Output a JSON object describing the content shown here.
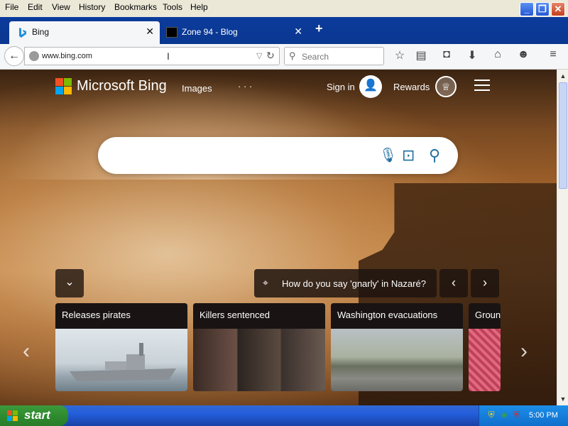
{
  "menu": {
    "items": [
      "File",
      "Edit",
      "View",
      "History",
      "Bookmarks",
      "Tools",
      "Help"
    ]
  },
  "window_controls": {
    "minimize": "_",
    "maximize": "❐",
    "close": "✕"
  },
  "tabs": [
    {
      "title": "Bing",
      "icon": "bing-logo-icon",
      "active": true
    },
    {
      "title": "Zone 94 - Blog",
      "icon": "zone94-favicon-icon",
      "active": false
    }
  ],
  "new_tab_label": "+",
  "navbar": {
    "url": "www.bing.com",
    "search_placeholder": "Search",
    "icons": [
      "star-icon",
      "reading-list-icon",
      "pocket-icon",
      "download-icon",
      "home-icon",
      "smiley-icon",
      "menu-icon"
    ]
  },
  "bing": {
    "brand": "Microsoft Bing",
    "nav_images": "Images",
    "nav_more": "· · ·",
    "sign_in": "Sign in",
    "rewards": "Rewards",
    "trivia_question": "How do you say 'gnarly' in Nazaré?",
    "news_cards": [
      {
        "caption": "Releases pirates"
      },
      {
        "caption": "Killers sentenced"
      },
      {
        "caption": "Washington evacuations"
      },
      {
        "caption": "Ground"
      }
    ]
  },
  "taskbar": {
    "start_label": "start",
    "clock": "5:00 PM"
  },
  "colors": {
    "tab_strip": "#0a3790",
    "taskbar": "#245edb",
    "start_button": "#2e8b2e",
    "bing_accent": "#1f6fa0"
  }
}
